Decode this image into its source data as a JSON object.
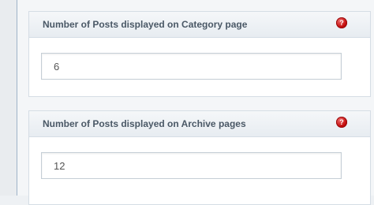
{
  "options": [
    {
      "title": "Number of Posts displayed on Category page",
      "help_symbol": "?",
      "value": "6"
    },
    {
      "title": "Number of Posts displayed on Archive pages",
      "help_symbol": "?",
      "value": "12"
    }
  ],
  "colors": {
    "help_icon": "#c40e0e",
    "header_text": "#4a5866"
  }
}
